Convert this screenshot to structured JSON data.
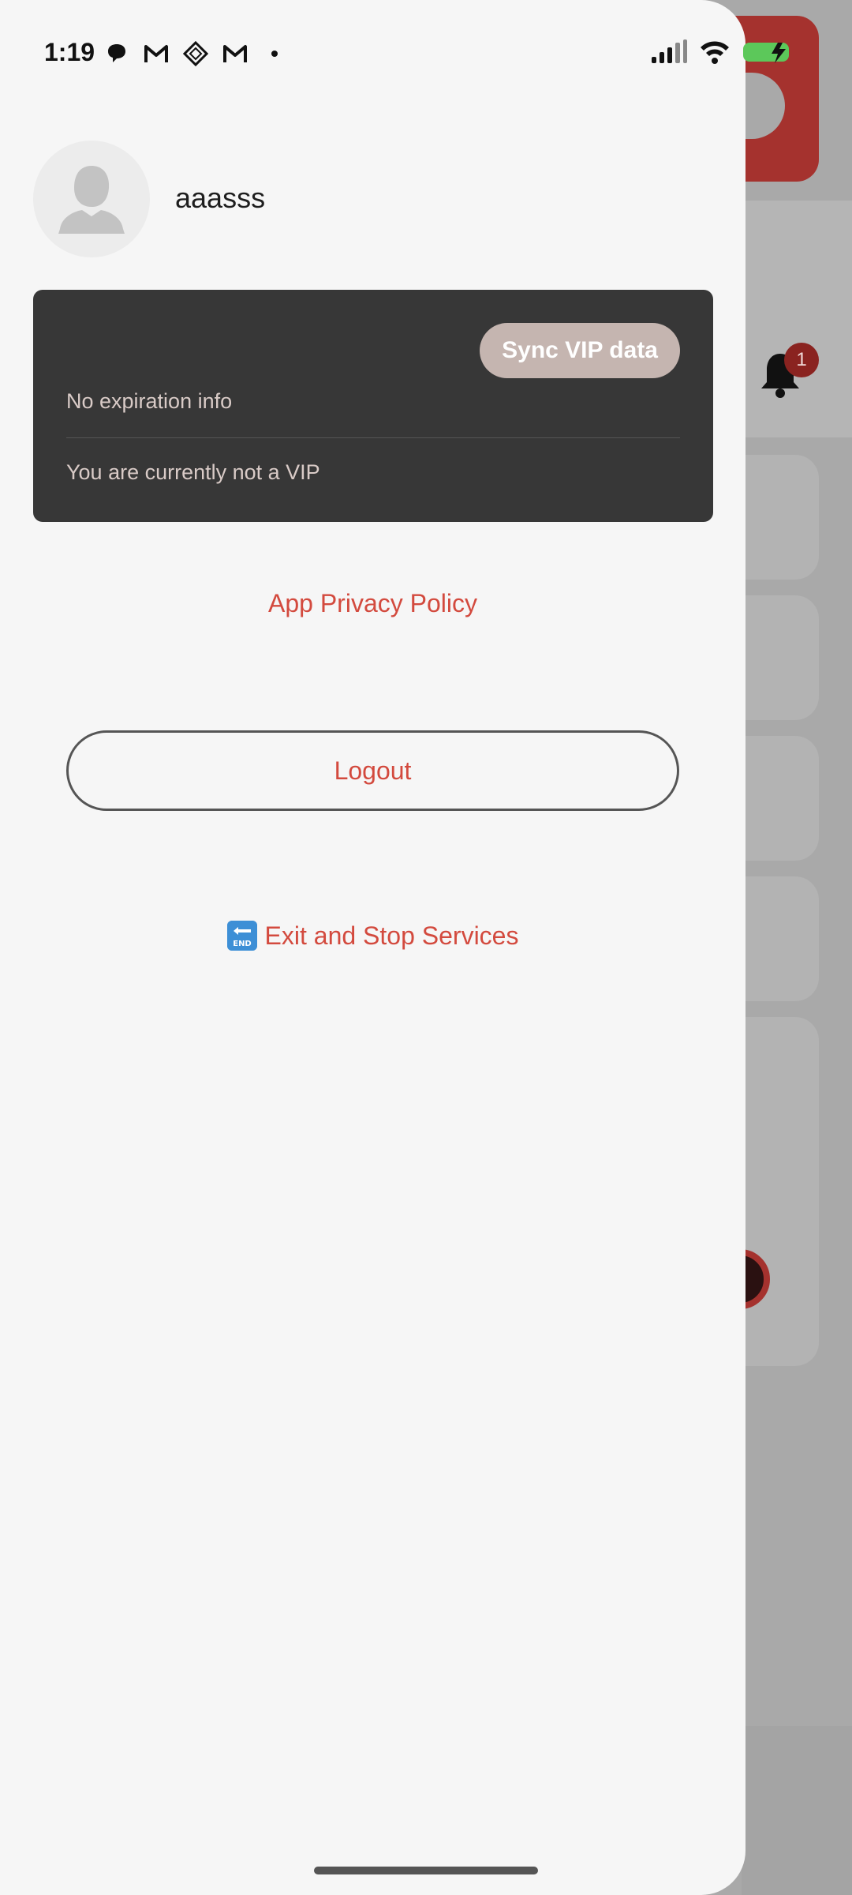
{
  "status_bar": {
    "time": "1:19",
    "left_icons": [
      "chat-bubble-icon",
      "gmail-icon",
      "diamond-app-icon",
      "gmail-icon",
      "dot-icon"
    ],
    "right_icons": [
      "signal-icon",
      "wifi-icon",
      "battery-charging-icon"
    ],
    "battery_color": "#5cc85a"
  },
  "profile": {
    "username": "aaasss",
    "avatar_icon": "user-silhouette-icon"
  },
  "vip_card": {
    "sync_button_label": "Sync VIP data",
    "expiry_text": "No expiration info",
    "status_text": "You are currently not a VIP"
  },
  "links": {
    "privacy_policy": "App Privacy Policy",
    "logout": "Logout",
    "exit_icon": "end-arrow-icon",
    "exit_label": "Exit and Stop Services"
  },
  "background": {
    "notification_badge": "1",
    "accent_color": "#a5322e"
  },
  "colors": {
    "accent_text": "#d34a3e",
    "card_bg": "#373737",
    "drawer_bg": "#f6f6f6"
  }
}
